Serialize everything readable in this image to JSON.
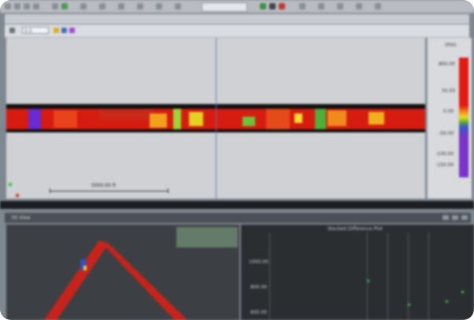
{
  "toolbar": {
    "zoom_value": "1:1",
    "icons": [
      "folder-icon",
      "save-icon",
      "undo-icon",
      "redo-icon",
      "pointer-icon",
      "zoom-icon",
      "pan-icon",
      "settings-icon"
    ]
  },
  "main_view": {
    "scale_bar_label": "5000.00 ft"
  },
  "colorbar": {
    "title": "(PHI)",
    "labels": [
      "800.00",
      "50.00",
      "0.00",
      "-50.00",
      "-100.00",
      "-150.00"
    ],
    "colors": [
      "#e31a11",
      "#f49a18",
      "#dfe222",
      "#58a63a",
      "#3a56c9",
      "#7a34c7"
    ]
  },
  "lower_panel": {
    "left_title": "3D View",
    "right_title": "Stacked Difference Plot",
    "right_yticks": [
      "1000.00",
      "800.00",
      "600.00"
    ]
  }
}
